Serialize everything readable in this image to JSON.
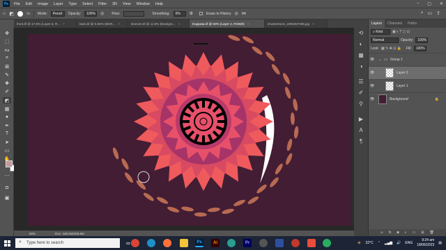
{
  "app": {
    "logo": "Ps",
    "menu": [
      "File",
      "Edit",
      "Image",
      "Layer",
      "Type",
      "Select",
      "Filter",
      "3D",
      "View",
      "Window",
      "Help"
    ]
  },
  "options": {
    "mode_label": "Mode:",
    "mode_value": "Pencil",
    "opacity_label": "Opacity:",
    "opacity_value": "100%",
    "flow_label": "Flow:",
    "smoothing_label": "Smoothing:",
    "smoothing_value": "0%",
    "erase_history": "Erase to History"
  },
  "tabs": [
    {
      "label": "front.tif @ 17.8% (Layer 6, R..."
    },
    {
      "label": "back.tif @ 6.56% (BGR..."
    },
    {
      "label": "sleeves.tif @ 11.8% (Backgro..."
    },
    {
      "label": "Duppata.tif @ 50% (Layer 2, RGB/8)"
    },
    {
      "label": "shutterstock_2295387285.jpg"
    }
  ],
  "status": {
    "zoom": "50%",
    "doc": "Doc: 448.6M/269.6M"
  },
  "panel": {
    "tabs": [
      "Layers",
      "Channels",
      "Paths"
    ],
    "kind": "Kind",
    "blend": "Normal",
    "opacity_label": "Opacity:",
    "opacity_value": "100%",
    "lock_label": "Lock:",
    "fill_label": "Fill:",
    "fill_value": "100%",
    "layers": [
      {
        "name": "Group 1",
        "type": "group"
      },
      {
        "name": "Layer 2",
        "type": "layer",
        "selected": true
      },
      {
        "name": "Layer 1",
        "type": "layer"
      },
      {
        "name": "Background",
        "type": "background"
      }
    ]
  },
  "taskbar": {
    "search_placeholder": "Type here to search",
    "temp": "32°C",
    "lang": "ENG",
    "time": "9:24 am",
    "date": "18/06/2023"
  },
  "colors": {
    "canvas": "#431d33",
    "accent": "#31a8ff",
    "mandala_outer": "#ef5a5d",
    "mandala_inner": "#a63468",
    "leaf": "#b86a52"
  }
}
